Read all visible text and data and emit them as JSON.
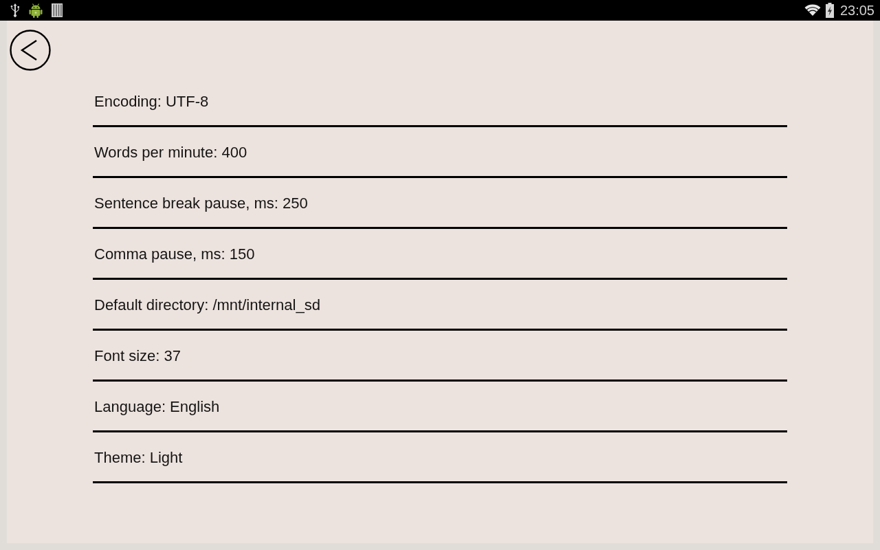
{
  "status_bar": {
    "time": "23:05"
  },
  "settings": [
    {
      "label": "Encoding: UTF-8"
    },
    {
      "label": "Words per minute: 400"
    },
    {
      "label": "Sentence break pause, ms: 250"
    },
    {
      "label": "Comma pause, ms: 150"
    },
    {
      "label": "Default directory: /mnt/internal_sd"
    },
    {
      "label": "Font size: 37"
    },
    {
      "label": "Language: English"
    },
    {
      "label": "Theme: Light"
    }
  ]
}
